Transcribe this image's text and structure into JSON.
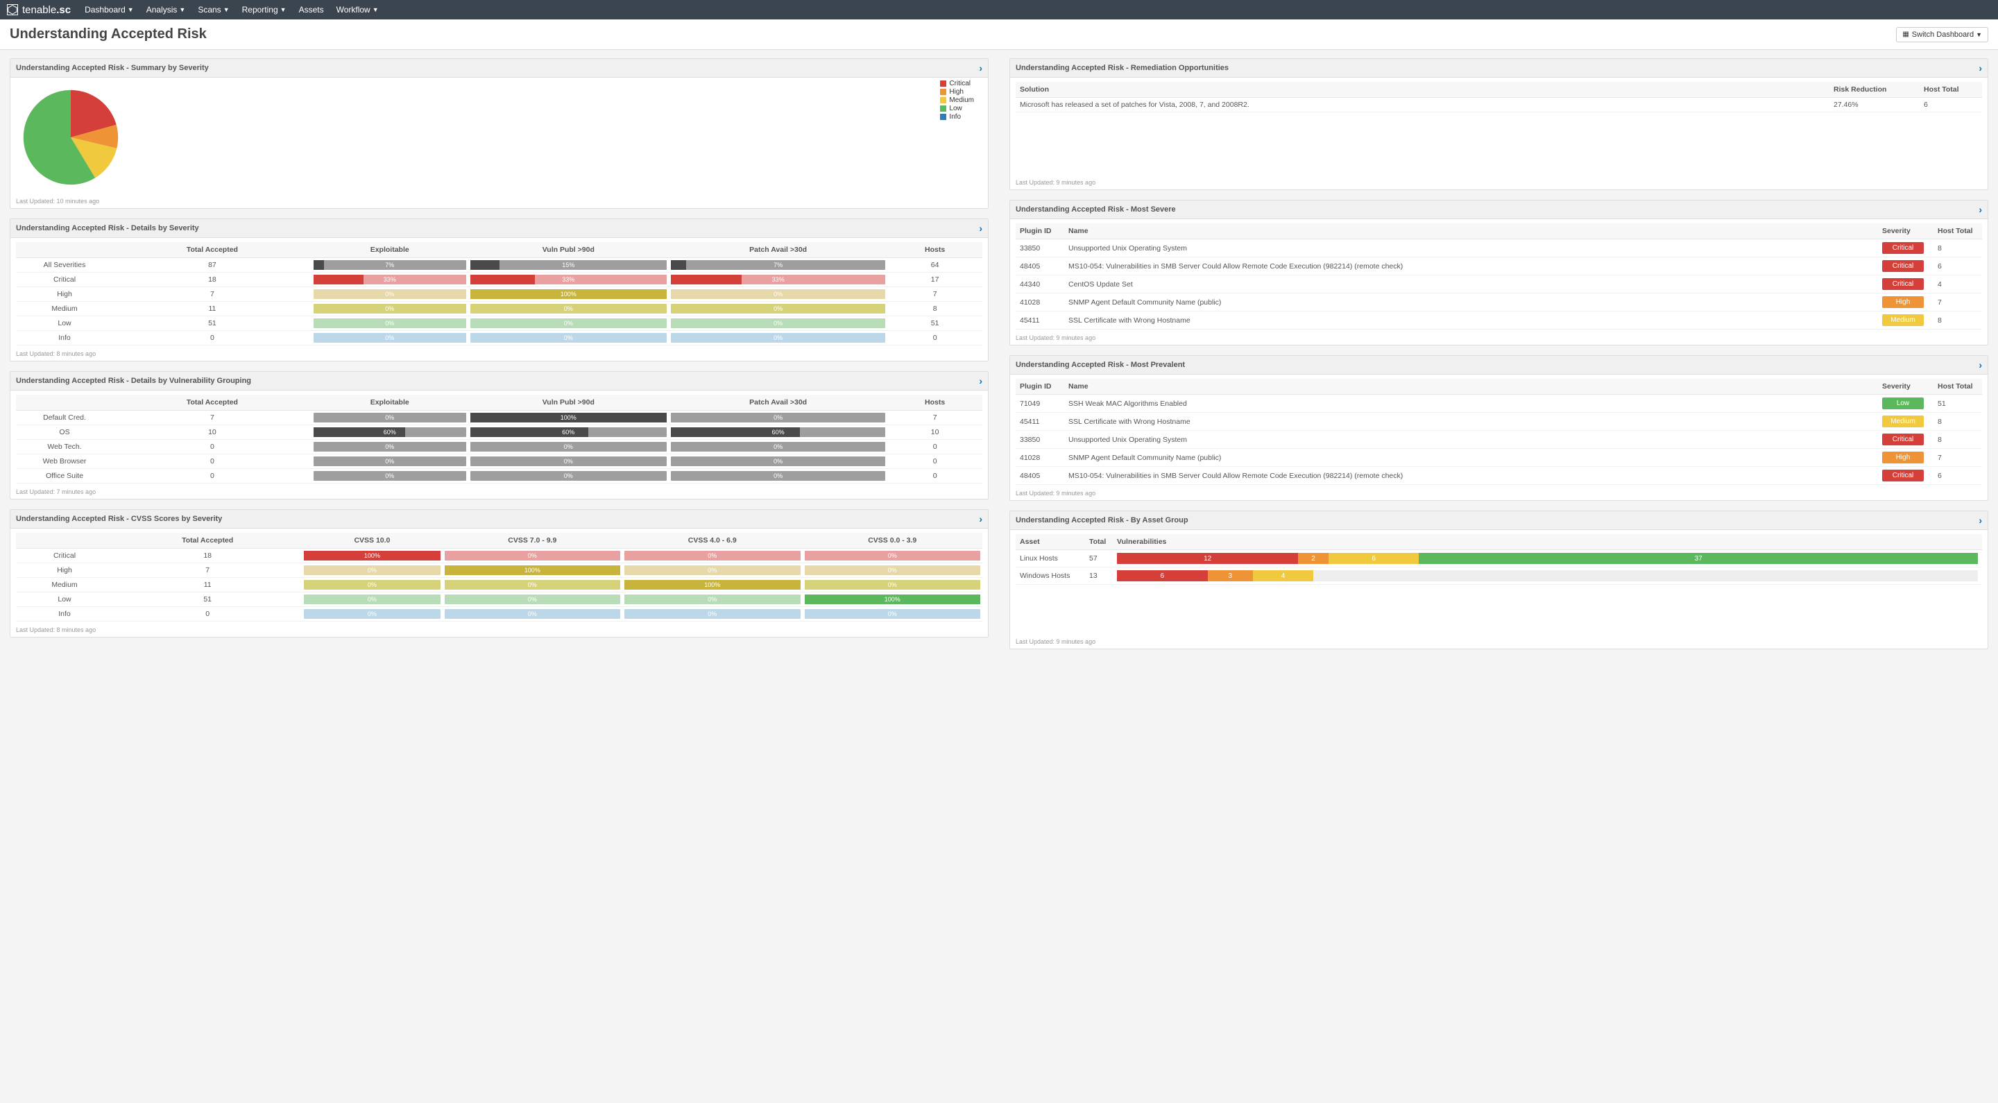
{
  "brand": {
    "name": "tenable",
    "suffix": ".sc"
  },
  "nav": [
    "Dashboard",
    "Analysis",
    "Scans",
    "Reporting",
    "Assets",
    "Workflow"
  ],
  "nav_caret": [
    true,
    true,
    true,
    true,
    false,
    true
  ],
  "page_title": "Understanding Accepted Risk",
  "switch_label": "Switch Dashboard",
  "colors": {
    "Critical": "#d43f3a",
    "High": "#ee9336",
    "Medium": "#f0c93e",
    "Low": "#5cb85c",
    "Info": "#337ab7",
    "gray": "#9e9e9e",
    "dark": "#4a4a4a",
    "yellow_med": "#c9b43b",
    "pink": "#e8a0a0",
    "tan": "#e6d8a8",
    "lightgreen": "#b8dcb8",
    "lightblue": "#bcd8e8",
    "olive": "#d6d27a"
  },
  "chart_data": {
    "type": "pie",
    "title": "Understanding Accepted Risk - Summary by Severity",
    "series": [
      {
        "name": "Critical",
        "value": 18,
        "color": "#d43f3a"
      },
      {
        "name": "High",
        "value": 7,
        "color": "#ee9336"
      },
      {
        "name": "Medium",
        "value": 11,
        "color": "#f0c93e"
      },
      {
        "name": "Low",
        "value": 51,
        "color": "#5cb85c"
      },
      {
        "name": "Info",
        "value": 0,
        "color": "#337ab7"
      }
    ],
    "legend": [
      "Critical",
      "High",
      "Medium",
      "Low",
      "Info"
    ]
  },
  "panels": {
    "summary": {
      "title": "Understanding Accepted Risk - Summary by Severity",
      "updated": "Last Updated: 10 minutes ago"
    },
    "details_sev": {
      "title": "Understanding Accepted Risk - Details by Severity",
      "updated": "Last Updated: 8 minutes ago",
      "headers": [
        "",
        "Total Accepted",
        "Exploitable",
        "Vuln Publ >90d",
        "Patch Avail >30d",
        "Hosts"
      ],
      "rows": [
        {
          "label": "All Severities",
          "total": 87,
          "exp": {
            "v": "7%",
            "fill": 7,
            "c": "dark",
            "bg": "gray"
          },
          "vp": {
            "v": "15%",
            "fill": 15,
            "c": "dark",
            "bg": "gray"
          },
          "pa": {
            "v": "7%",
            "fill": 7,
            "c": "dark",
            "bg": "gray"
          },
          "hosts": 64
        },
        {
          "label": "Critical",
          "total": 18,
          "exp": {
            "v": "33%",
            "fill": 33,
            "c": "Critical",
            "bg": "pink"
          },
          "vp": {
            "v": "33%",
            "fill": 33,
            "c": "Critical",
            "bg": "pink"
          },
          "pa": {
            "v": "33%",
            "fill": 33,
            "c": "Critical",
            "bg": "pink"
          },
          "hosts": 17
        },
        {
          "label": "High",
          "total": 7,
          "exp": {
            "v": "0%",
            "fill": 0,
            "c": "High",
            "bg": "tan"
          },
          "vp": {
            "v": "100%",
            "fill": 100,
            "c": "yellow_med",
            "bg": "tan"
          },
          "pa": {
            "v": "0%",
            "fill": 0,
            "c": "High",
            "bg": "tan"
          },
          "hosts": 7
        },
        {
          "label": "Medium",
          "total": 11,
          "exp": {
            "v": "0%",
            "fill": 0,
            "c": "Medium",
            "bg": "olive"
          },
          "vp": {
            "v": "0%",
            "fill": 0,
            "c": "Medium",
            "bg": "olive"
          },
          "pa": {
            "v": "0%",
            "fill": 0,
            "c": "Medium",
            "bg": "olive"
          },
          "hosts": 8
        },
        {
          "label": "Low",
          "total": 51,
          "exp": {
            "v": "0%",
            "fill": 0,
            "c": "Low",
            "bg": "lightgreen"
          },
          "vp": {
            "v": "0%",
            "fill": 0,
            "c": "Low",
            "bg": "lightgreen"
          },
          "pa": {
            "v": "0%",
            "fill": 0,
            "c": "Low",
            "bg": "lightgreen"
          },
          "hosts": 51
        },
        {
          "label": "Info",
          "total": 0,
          "exp": {
            "v": "0%",
            "fill": 0,
            "c": "Info",
            "bg": "lightblue"
          },
          "vp": {
            "v": "0%",
            "fill": 0,
            "c": "Info",
            "bg": "lightblue"
          },
          "pa": {
            "v": "0%",
            "fill": 0,
            "c": "Info",
            "bg": "lightblue"
          },
          "hosts": 0
        }
      ]
    },
    "details_vuln": {
      "title": "Understanding Accepted Risk - Details by Vulnerability Grouping",
      "updated": "Last Updated: 7 minutes ago",
      "headers": [
        "",
        "Total Accepted",
        "Exploitable",
        "Vuln Publ >90d",
        "Patch Avail >30d",
        "Hosts"
      ],
      "rows": [
        {
          "label": "Default Cred.",
          "total": 7,
          "exp": {
            "v": "0%",
            "fill": 0
          },
          "vp": {
            "v": "100%",
            "fill": 100,
            "dark": true
          },
          "pa": {
            "v": "0%",
            "fill": 0
          },
          "hosts": 7
        },
        {
          "label": "OS",
          "total": 10,
          "exp": {
            "v": "60%",
            "fill": 60,
            "dark": true
          },
          "vp": {
            "v": "60%",
            "fill": 60,
            "dark": true
          },
          "pa": {
            "v": "60%",
            "fill": 60,
            "dark": true
          },
          "hosts": 10
        },
        {
          "label": "Web Tech.",
          "total": 0,
          "exp": {
            "v": "0%",
            "fill": 0
          },
          "vp": {
            "v": "0%",
            "fill": 0
          },
          "pa": {
            "v": "0%",
            "fill": 0
          },
          "hosts": 0
        },
        {
          "label": "Web Browser",
          "total": 0,
          "exp": {
            "v": "0%",
            "fill": 0
          },
          "vp": {
            "v": "0%",
            "fill": 0
          },
          "pa": {
            "v": "0%",
            "fill": 0
          },
          "hosts": 0
        },
        {
          "label": "Office Suite",
          "total": 0,
          "exp": {
            "v": "0%",
            "fill": 0
          },
          "vp": {
            "v": "0%",
            "fill": 0
          },
          "pa": {
            "v": "0%",
            "fill": 0
          },
          "hosts": 0
        }
      ]
    },
    "cvss": {
      "title": "Understanding Accepted Risk - CVSS Scores by Severity",
      "updated": "Last Updated: 8 minutes ago",
      "headers": [
        "",
        "Total Accepted",
        "CVSS 10.0",
        "CVSS 7.0 - 9.9",
        "CVSS 4.0 - 6.9",
        "CVSS 0.0 - 3.9"
      ],
      "rows": [
        {
          "label": "Critical",
          "total": 18,
          "c": "Critical",
          "bg": "pink",
          "cells": [
            "100%",
            "0%",
            "0%",
            "0%"
          ],
          "fill": [
            100,
            0,
            0,
            0
          ]
        },
        {
          "label": "High",
          "total": 7,
          "c": "yellow_med",
          "bg": "tan",
          "cells": [
            "0%",
            "100%",
            "0%",
            "0%"
          ],
          "fill": [
            0,
            100,
            0,
            0
          ]
        },
        {
          "label": "Medium",
          "total": 11,
          "c": "yellow_med",
          "bg": "olive",
          "cells": [
            "0%",
            "0%",
            "100%",
            "0%"
          ],
          "fill": [
            0,
            0,
            100,
            0
          ]
        },
        {
          "label": "Low",
          "total": 51,
          "c": "Low",
          "bg": "lightgreen",
          "cells": [
            "0%",
            "0%",
            "0%",
            "100%"
          ],
          "fill": [
            0,
            0,
            0,
            100
          ]
        },
        {
          "label": "Info",
          "total": 0,
          "c": "Info",
          "bg": "lightblue",
          "cells": [
            "0%",
            "0%",
            "0%",
            "0%"
          ],
          "fill": [
            0,
            0,
            0,
            0
          ]
        }
      ]
    },
    "remediation": {
      "title": "Understanding Accepted Risk - Remediation Opportunities",
      "updated": "Last Updated: 9 minutes ago",
      "headers": [
        "Solution",
        "Risk Reduction",
        "Host Total"
      ],
      "rows": [
        {
          "solution": "Microsoft has released a set of patches for Vista, 2008, 7, and 2008​R2.",
          "risk": "27.46%",
          "hosts": 6
        }
      ]
    },
    "most_severe": {
      "title": "Understanding Accepted Risk - Most Severe",
      "updated": "Last Updated: 9 minutes ago",
      "headers": [
        "Plugin ID",
        "Name",
        "Severity",
        "Host Total"
      ],
      "rows": [
        {
          "id": "33850",
          "name": "Unsupported Unix Operating System",
          "sev": "Critical",
          "hosts": 8
        },
        {
          "id": "48405",
          "name": "MS10-054: Vulnerabilities in SMB Server Could Allow Remote Code Execution (982214) (remote check)",
          "sev": "Critical",
          "hosts": 6
        },
        {
          "id": "44340",
          "name": "CentOS Update Set",
          "sev": "Critical",
          "hosts": 4
        },
        {
          "id": "41028",
          "name": "SNMP Agent Default Community Name (public)",
          "sev": "High",
          "hosts": 7
        },
        {
          "id": "45411",
          "name": "SSL Certificate with Wrong Hostname",
          "sev": "Medium",
          "hosts": 8
        }
      ]
    },
    "most_prevalent": {
      "title": "Understanding Accepted Risk - Most Prevalent",
      "updated": "Last Updated: 9 minutes ago",
      "headers": [
        "Plugin ID",
        "Name",
        "Severity",
        "Host Total"
      ],
      "rows": [
        {
          "id": "71049",
          "name": "SSH Weak MAC Algorithms Enabled",
          "sev": "Low",
          "hosts": 51
        },
        {
          "id": "45411",
          "name": "SSL Certificate with Wrong Hostname",
          "sev": "Medium",
          "hosts": 8
        },
        {
          "id": "33850",
          "name": "Unsupported Unix Operating System",
          "sev": "Critical",
          "hosts": 8
        },
        {
          "id": "41028",
          "name": "SNMP Agent Default Community Name (public)",
          "sev": "High",
          "hosts": 7
        },
        {
          "id": "48405",
          "name": "MS10-054: Vulnerabilities in SMB Server Could Allow Remote Code Execution (982214) (remote check)",
          "sev": "Critical",
          "hosts": 6
        }
      ]
    },
    "asset_group": {
      "title": "Understanding Accepted Risk - By Asset Group",
      "updated": "Last Updated: 9 minutes ago",
      "headers": [
        "Asset",
        "Total",
        "Vulnerabilities"
      ],
      "rows": [
        {
          "asset": "Linux Hosts",
          "total": 57,
          "segs": [
            {
              "v": 12,
              "c": "Critical"
            },
            {
              "v": 2,
              "c": "High"
            },
            {
              "v": 6,
              "c": "Medium"
            },
            {
              "v": 37,
              "c": "Low"
            }
          ]
        },
        {
          "asset": "Windows Hosts",
          "total": 13,
          "segs": [
            {
              "v": 6,
              "c": "Critical"
            },
            {
              "v": 3,
              "c": "High"
            },
            {
              "v": 4,
              "c": "Medium"
            }
          ]
        }
      ]
    }
  }
}
